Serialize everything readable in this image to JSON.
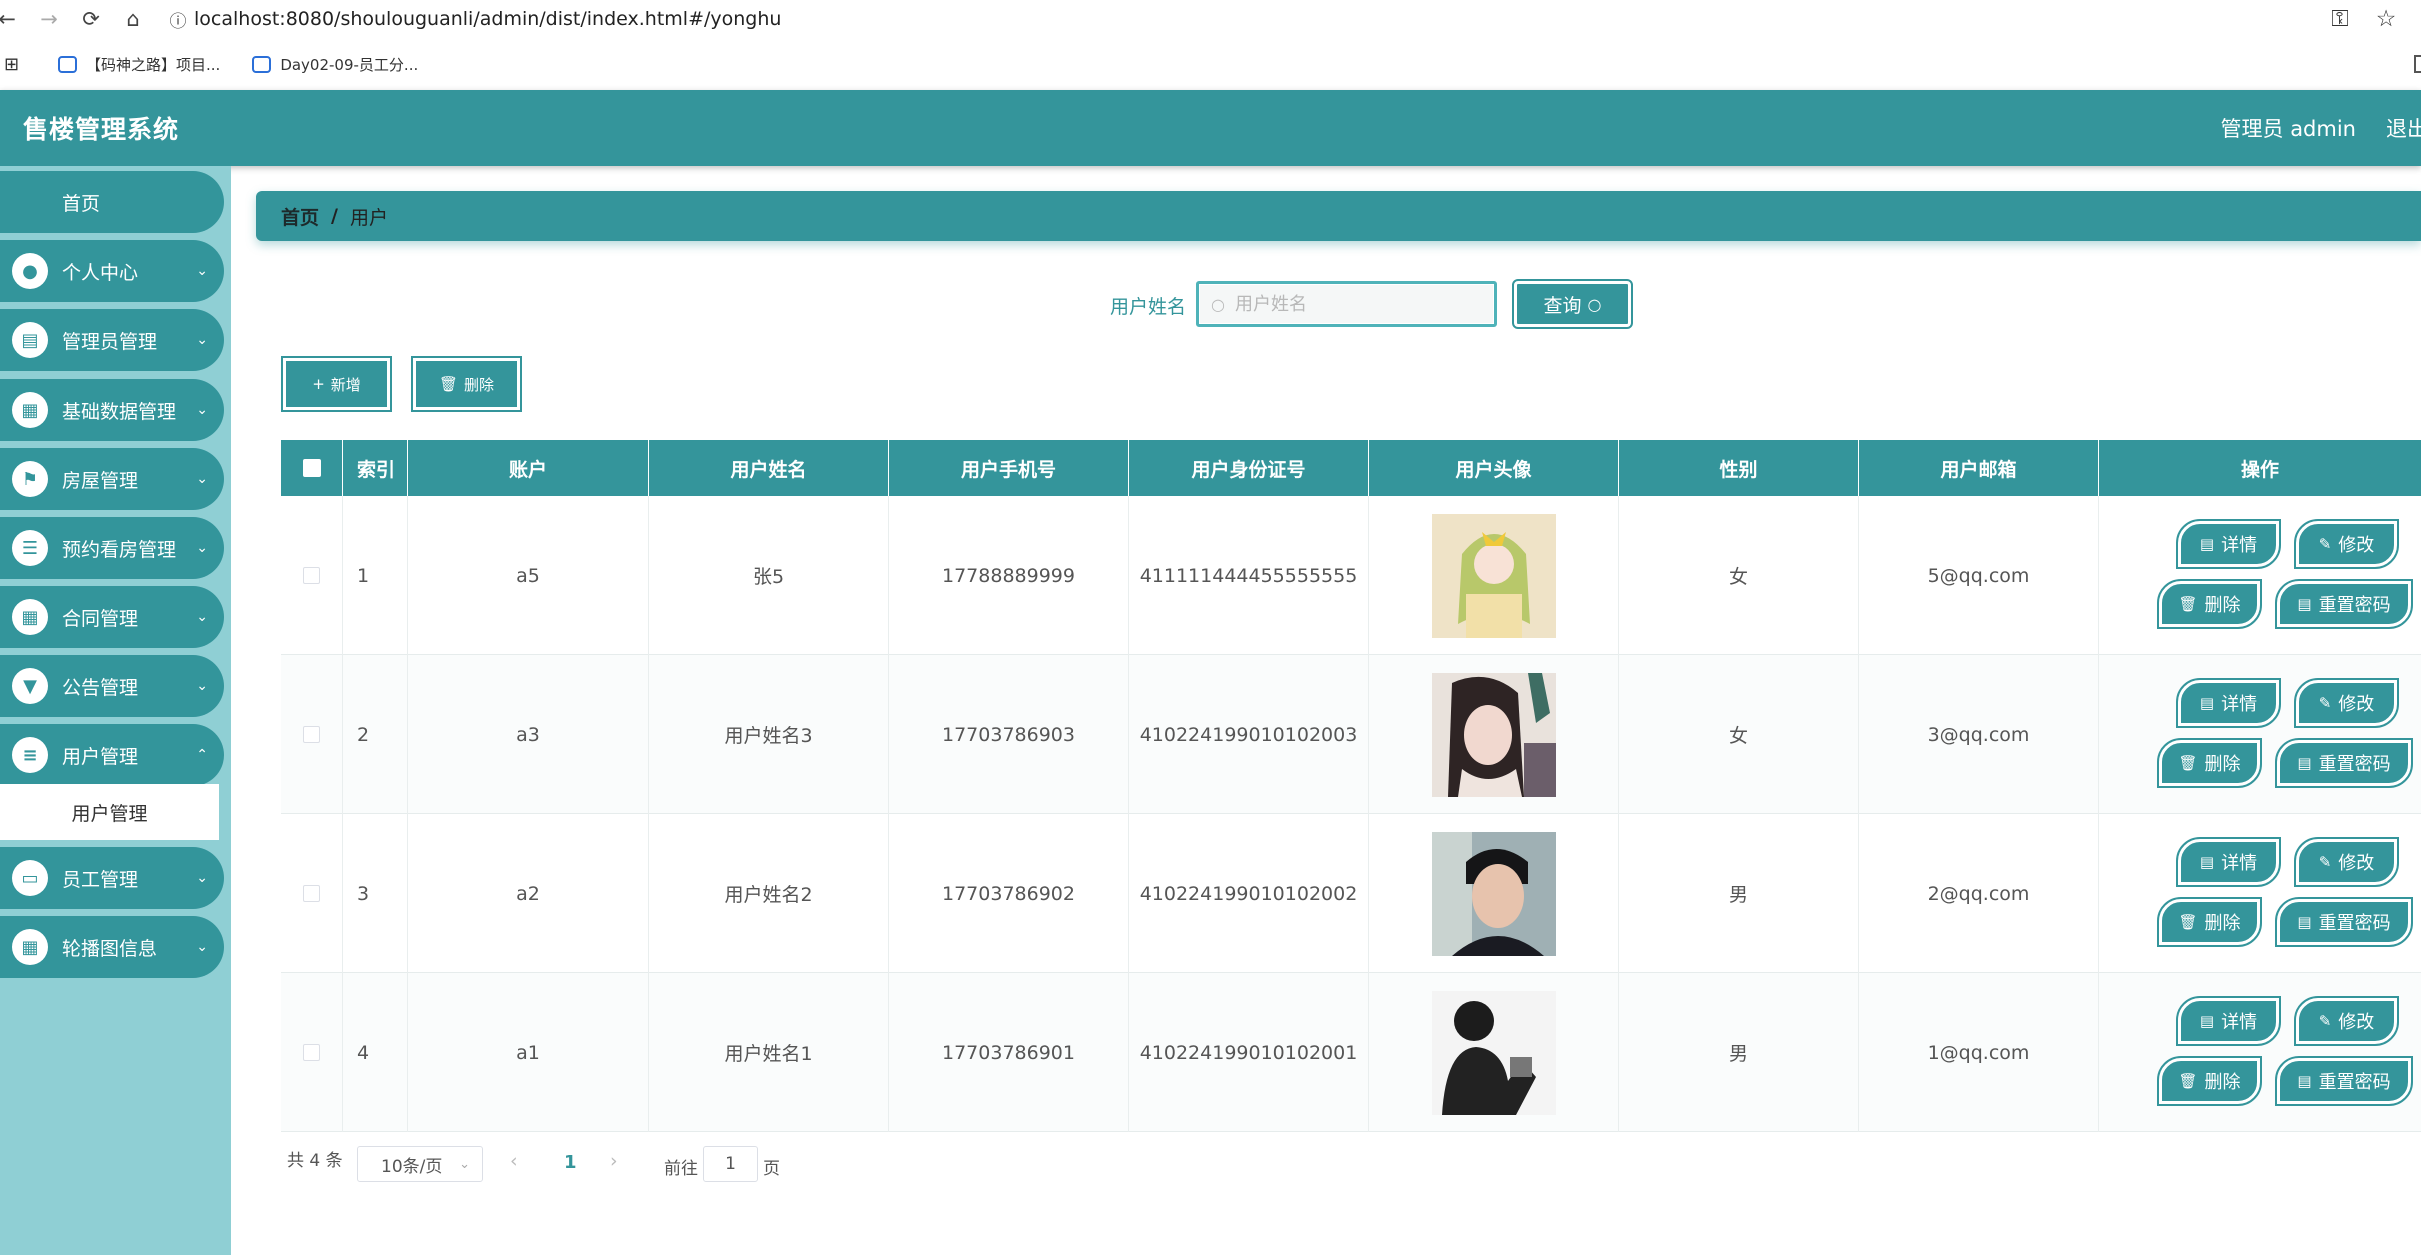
{
  "browser": {
    "url": "localhost:8080/shoulouguanli/admin/dist/index.html#/yonghu",
    "bookmarks": [
      "【码神之路】项目...",
      "Day02-09-员工分..."
    ]
  },
  "app": {
    "title": "售楼管理系统",
    "user": "管理员 admin",
    "logout": "退出",
    "accent_color": "#34959b",
    "sidebar_color": "#8fcfd4"
  },
  "sidebar": {
    "home": "首页",
    "items": [
      {
        "label": "个人中心",
        "icon": "user-icon"
      },
      {
        "label": "管理员管理",
        "icon": "clipboard-icon"
      },
      {
        "label": "基础数据管理",
        "icon": "grid-icon"
      },
      {
        "label": "房屋管理",
        "icon": "flag-icon"
      },
      {
        "label": "预约看房管理",
        "icon": "sliders-icon"
      },
      {
        "label": "合同管理",
        "icon": "grid-icon"
      },
      {
        "label": "公告管理",
        "icon": "pin-icon"
      },
      {
        "label": "用户管理",
        "icon": "list-icon"
      },
      {
        "label": "员工管理",
        "icon": "monitor-icon"
      },
      {
        "label": "轮播图信息",
        "icon": "grid-icon"
      }
    ],
    "submenu": "用户管理"
  },
  "breadcrumb": {
    "home": "首页",
    "sep": "/",
    "current": "用户"
  },
  "search": {
    "label": "用户姓名",
    "placeholder": "用户姓名",
    "button": "查询"
  },
  "toolbar": {
    "add": "新增",
    "delete": "删除"
  },
  "table": {
    "headers": [
      "索引",
      "账户",
      "用户姓名",
      "用户手机号",
      "用户身份证号",
      "用户头像",
      "性别",
      "用户邮箱",
      "操作"
    ],
    "rows": [
      {
        "index": "1",
        "account": "a5",
        "name": "张5",
        "phone": "17788889999",
        "idcard": "411111444455555555",
        "gender": "女",
        "email": "5@qq.com"
      },
      {
        "index": "2",
        "account": "a3",
        "name": "用户姓名3",
        "phone": "17703786903",
        "idcard": "410224199010102003",
        "gender": "女",
        "email": "3@qq.com"
      },
      {
        "index": "3",
        "account": "a2",
        "name": "用户姓名2",
        "phone": "17703786902",
        "idcard": "410224199010102002",
        "gender": "男",
        "email": "2@qq.com"
      },
      {
        "index": "4",
        "account": "a1",
        "name": "用户姓名1",
        "phone": "17703786901",
        "idcard": "410224199010102001",
        "gender": "男",
        "email": "1@qq.com"
      }
    ],
    "actions": {
      "detail": "详情",
      "edit": "修改",
      "delete": "删除",
      "reset": "重置密码"
    }
  },
  "pagination": {
    "total": "共 4 条",
    "page_size": "10条/页",
    "current": "1",
    "goto_label": "前往",
    "goto_value": "1",
    "page_suffix": "页"
  }
}
